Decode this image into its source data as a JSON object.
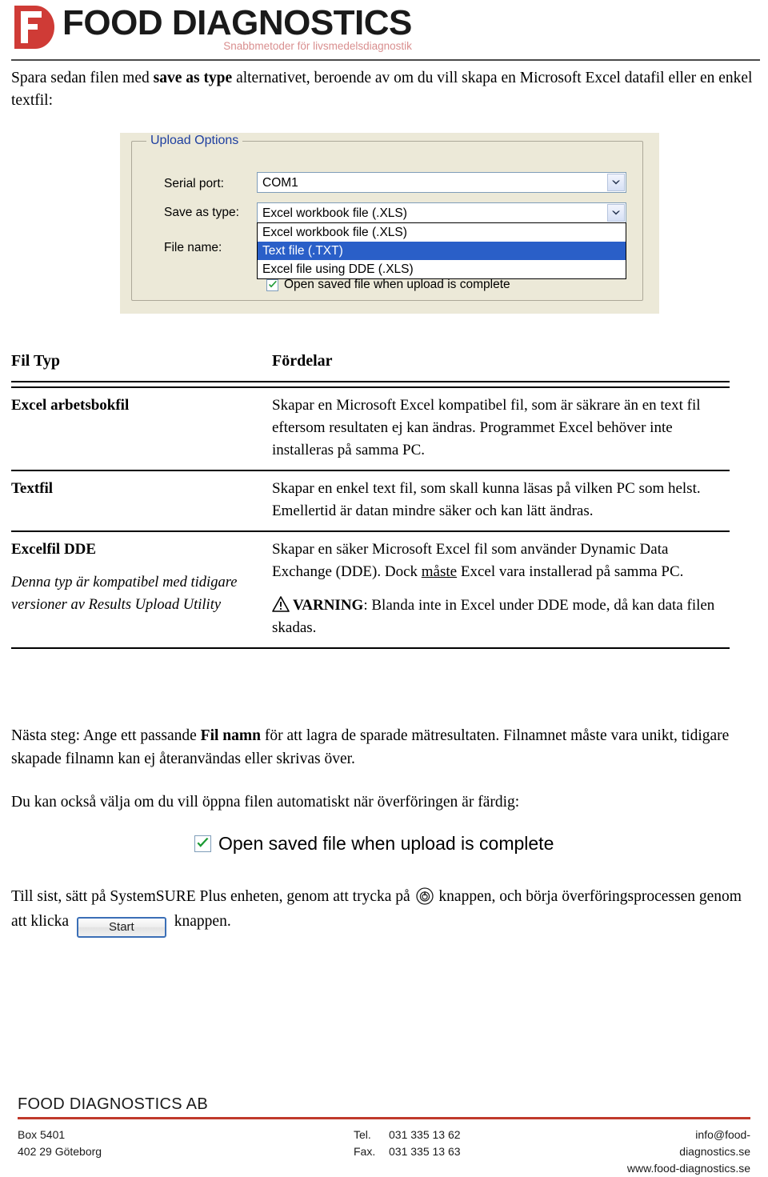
{
  "header": {
    "logo_word": "FOOD DIAGNOSTICS",
    "logo_tagline": "Snabbmetoder för livsmedelsdiagnostik",
    "logo_mark_letters": "FD",
    "brand_red": "#cf3b36",
    "tagline_color": "#d98f8f"
  },
  "intro": {
    "part1": "Spara sedan filen med ",
    "emphasis": "save as type",
    "part2": " alternativet, beroende av om du vill skapa en Microsoft Excel datafil eller en enkel textfil:"
  },
  "dialog": {
    "group_title": "Upload Options",
    "serial_port_label": "Serial port:",
    "serial_port_value": "COM1",
    "save_as_type_label": "Save as type:",
    "save_as_type_value": "Excel workbook file (.XLS)",
    "file_name_label": "File name:",
    "dropdown_options": [
      "Excel workbook file (.XLS)",
      "Text file (.TXT)",
      "Excel file using DDE (.XLS)"
    ],
    "dropdown_selected_index": 1,
    "checkbox_label": "Open saved file when upload is complete",
    "checkbox_checked": true,
    "background_color": "#ece9d8",
    "legend_color": "#1e3fa0",
    "selection_color": "#2a5fc8"
  },
  "table": {
    "headers": {
      "col_a": "Fil Typ",
      "col_b": "Fördelar"
    },
    "rows": [
      {
        "type": "Excel arbetsbokfil",
        "subtitle": "",
        "desc": "Skapar en Microsoft Excel kompatibel fil, som är säkrare än en text fil eftersom resultaten ej kan ändras. Programmet Excel behöver inte installeras på samma PC.",
        "warning": ""
      },
      {
        "type": "Textfil",
        "subtitle": "",
        "desc": "Skapar en enkel text fil, som skall kunna läsas på vilken PC som helst. Emellertid är datan mindre säker och kan lätt ändras.",
        "warning": ""
      },
      {
        "type": "Excelfil DDE",
        "subtitle": "Denna typ är kompatibel med tidigare versioner av Results Upload Utility",
        "desc_pre": "Skapar en säker Microsoft Excel fil som använder Dynamic Data Exchange (DDE). Dock ",
        "desc_underlined": "måste",
        "desc_post": " Excel vara installerad på samma PC.",
        "warning_word": "VARNING",
        "warning_text": ": Blanda inte in Excel under DDE mode, då kan data filen skadas."
      }
    ]
  },
  "paragraphs": {
    "next_step_pre": "Nästa steg: Ange ett passande ",
    "next_step_bold": "Fil namn",
    "next_step_post": " för att lagra de sparade mätresultaten. Filnamnet måste vara unikt, tidigare skapade filnamn kan ej återanvändas eller skrivas över.",
    "open_auto": "Du kan också välja om du vill öppna filen automatiskt när överföringen är färdig:",
    "final_pre": "Till sist, sätt på SystemSURE Plus enheten, genom att trycka på ",
    "final_mid": " knappen, och börja överföringsprocessen genom att klicka ",
    "final_button_label": "Start",
    "final_post": " knappen."
  },
  "checkbox_shot": {
    "label": "Open saved file when upload is complete",
    "checked": true
  },
  "footer": {
    "company": "FOOD DIAGNOSTICS AB",
    "address_line1": "Box 5401",
    "address_line2": "402 29 Göteborg",
    "tel_key": "Tel.",
    "tel_value": "031 335 13 62",
    "fax_key": "Fax.",
    "fax_value": "031 335 13 63",
    "email": "info@food-diagnostics.se",
    "website": "www.food-diagnostics.se",
    "rule_color": "#c0392b"
  }
}
